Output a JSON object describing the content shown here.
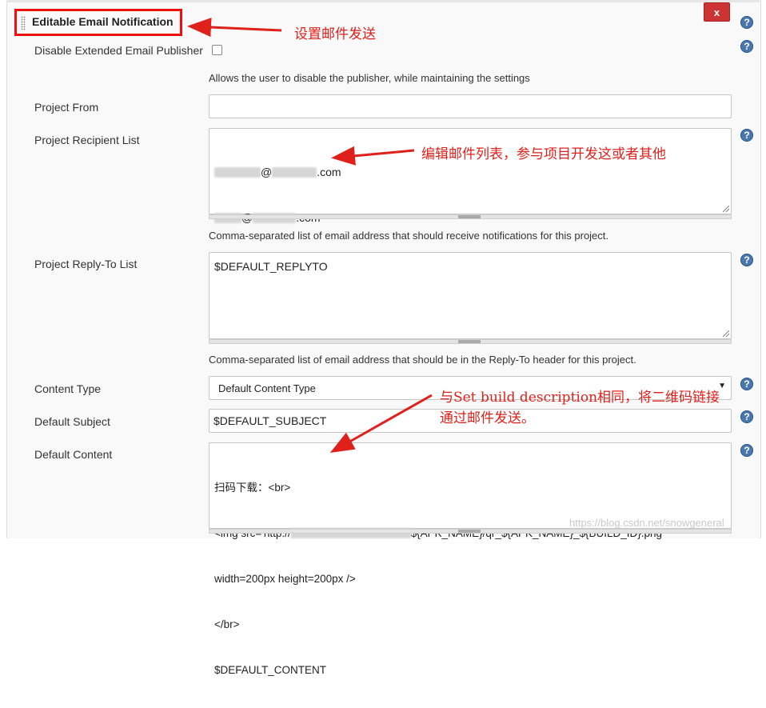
{
  "section": {
    "title": "Editable Email Notification",
    "close_label": "x",
    "help_symbol": "?"
  },
  "fields": {
    "disable_publisher": {
      "label": "Disable Extended Email Publisher",
      "checked": false,
      "description": "Allows the user to disable the publisher, while maintaining the settings"
    },
    "project_from": {
      "label": "Project From",
      "value": ""
    },
    "recipient_list": {
      "label": "Project Recipient List",
      "line1_at": "@",
      "line1_domain": ".com",
      "line2_at": "@",
      "line2_domain": ".com",
      "description": "Comma-separated list of email address that should receive notifications for this project."
    },
    "reply_to": {
      "label": "Project Reply-To List",
      "value": "$DEFAULT_REPLYTO",
      "description": "Comma-separated list of email address that should be in the Reply-To header for this project."
    },
    "content_type": {
      "label": "Content Type",
      "value": "Default Content Type",
      "arrow": "▼"
    },
    "default_subject": {
      "label": "Default Subject",
      "value": "$DEFAULT_SUBJECT"
    },
    "default_content": {
      "label": "Default Content",
      "line1": "扫码下载：<br>",
      "line2_prefix": "<img src='http://",
      "line2_suffix": "${APK_NAME}/qr_${APK_NAME}_${BUILD_ID}.png'",
      "line3": "width=200px height=200px />",
      "line4": "</br>",
      "line5": "$DEFAULT_CONTENT"
    }
  },
  "annotations": {
    "header_note": "设置邮件发送",
    "recipient_note": "编辑邮件列表，参与项目开发这或者其他",
    "content_note_line1_a": "与",
    "content_note_line1_b": "Set build description",
    "content_note_line1_c": "相同，将二维码链接",
    "content_note_line2": "通过邮件发送。",
    "color": "#e0201b"
  },
  "watermark": "https://blog.csdn.net/snowgeneral"
}
